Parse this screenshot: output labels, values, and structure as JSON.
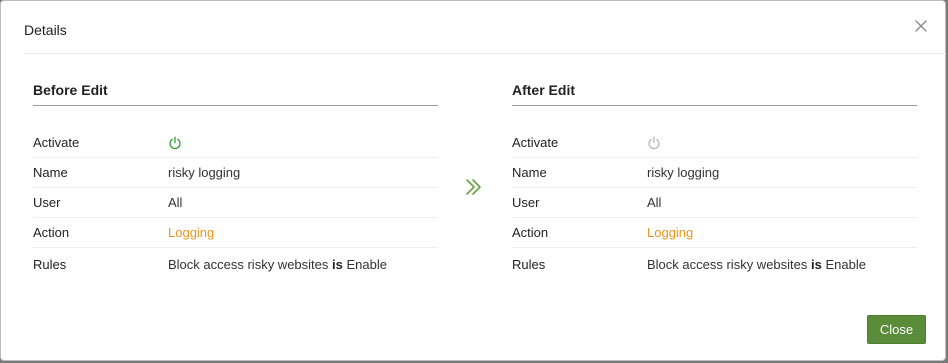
{
  "dialog": {
    "title": "Details",
    "close_icon": "close-icon",
    "close_button_label": "Close",
    "accent_color": "#5b8c3a",
    "action_color": "#e8961e"
  },
  "before": {
    "title": "Before Edit",
    "activate_label": "Activate",
    "activate_state": "on",
    "activate_icon": "power-icon",
    "activate_color": "#3a9a3a",
    "name_label": "Name",
    "name_value": "risky logging",
    "user_label": "User",
    "user_value": "All",
    "action_label": "Action",
    "action_value": "Logging",
    "rules_label": "Rules",
    "rules_prefix": "Block access risky websites",
    "rules_keyword": "is",
    "rules_suffix": "Enable"
  },
  "after": {
    "title": "After Edit",
    "activate_label": "Activate",
    "activate_state": "off",
    "activate_icon": "power-icon",
    "activate_color": "#b8b8b8",
    "name_label": "Name",
    "name_value": "risky logging",
    "user_label": "User",
    "user_value": "All",
    "action_label": "Action",
    "action_value": "Logging",
    "rules_label": "Rules",
    "rules_prefix": "Block access risky websites",
    "rules_keyword": "is",
    "rules_suffix": "Enable"
  },
  "transition_icon": "double-chevron-right-icon"
}
